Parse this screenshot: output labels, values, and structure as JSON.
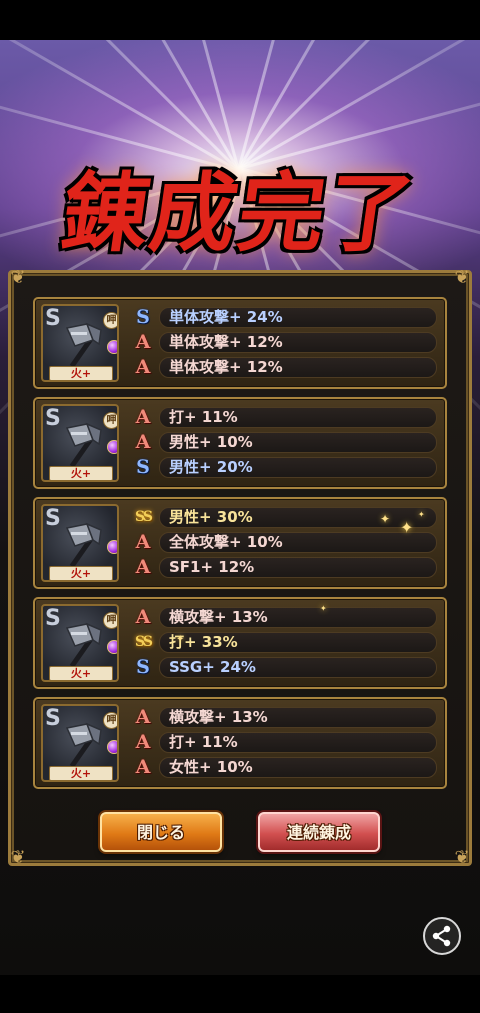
{
  "title": "錬成完了",
  "cards": [
    {
      "lock": "呷",
      "element": "火+",
      "rows": [
        {
          "rank": "S",
          "text": "単体攻撃+ 24%"
        },
        {
          "rank": "A",
          "text": "単体攻撃+ 12%"
        },
        {
          "rank": "A",
          "text": "単体攻撃+ 12%"
        }
      ]
    },
    {
      "lock": "呷",
      "element": "火+",
      "rows": [
        {
          "rank": "A",
          "text": "打+ 11%"
        },
        {
          "rank": "A",
          "text": "男性+ 10%"
        },
        {
          "rank": "S",
          "text": "男性+ 20%"
        }
      ]
    },
    {
      "lock": "",
      "element": "火+",
      "rows": [
        {
          "rank": "SS",
          "text": "男性+ 30%"
        },
        {
          "rank": "A",
          "text": "全体攻撃+ 10%"
        },
        {
          "rank": "A",
          "text": "SF1+ 12%"
        }
      ]
    },
    {
      "lock": "呷",
      "element": "火+",
      "rows": [
        {
          "rank": "A",
          "text": "横攻撃+ 13%"
        },
        {
          "rank": "SS",
          "text": "打+ 33%"
        },
        {
          "rank": "S",
          "text": "SSG+ 24%"
        }
      ]
    },
    {
      "lock": "呷",
      "element": "火+",
      "rows": [
        {
          "rank": "A",
          "text": "横攻撃+ 13%"
        },
        {
          "rank": "A",
          "text": "打+ 11%"
        },
        {
          "rank": "A",
          "text": "女性+ 10%"
        }
      ]
    }
  ],
  "buttons": {
    "close": "閉じる",
    "repeat": "連続錬成"
  },
  "icons": {
    "share": "share-icon",
    "weapon": "axe-icon",
    "gem": "purple-gem-icon",
    "lock": "lock-icon"
  },
  "colors": {
    "title": "#e0241a",
    "rank_A": "#f08a7a",
    "rank_S": "#8fb7ff",
    "rank_SS": "#f3cf59",
    "frame_gold": "#a8843e",
    "button_close": "#e07a16",
    "button_repeat": "#d25050"
  }
}
